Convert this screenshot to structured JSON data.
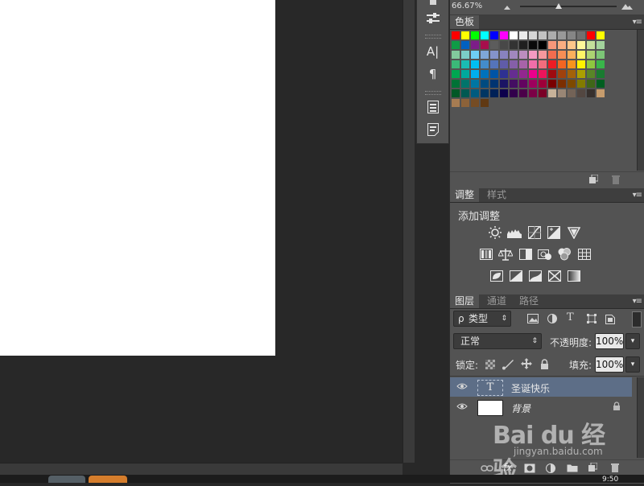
{
  "zoom": {
    "label": "66.67%"
  },
  "swatches_panel": {
    "tab": "色板",
    "colors": [
      "#ff0000",
      "#ffff00",
      "#00ff00",
      "#00ffff",
      "#0000ff",
      "#ff00ff",
      "#ffffff",
      "#ebebeb",
      "#d6d6d6",
      "#c2c2c2",
      "#adadad",
      "#999999",
      "#858585",
      "#707070",
      "#ff0000",
      "#ffff00",
      "#0e9c46",
      "#0060c0",
      "#7d1d88",
      "#a70e4c",
      "#5c5c5c",
      "#484848",
      "#333333",
      "#1f1f1f",
      "#0a0a0a",
      "#000000",
      "#f7977a",
      "#f9ad81",
      "#fdc68a",
      "#fff79a",
      "#c4df9b",
      "#a3d39c",
      "#82ca9d",
      "#7bcdc8",
      "#6ecff6",
      "#7ea7d8",
      "#8493ca",
      "#8882be",
      "#a187be",
      "#bc8dbf",
      "#f49ac2",
      "#f6989d",
      "#f26c4f",
      "#f68e55",
      "#fbaf5c",
      "#fff467",
      "#acd372",
      "#7cc576",
      "#3bb878",
      "#1abbb4",
      "#00bff3",
      "#438ccb",
      "#5574b9",
      "#605ca8",
      "#855fa8",
      "#a763a8",
      "#f06ea9",
      "#f26d7d",
      "#ed1c24",
      "#f26522",
      "#f7941d",
      "#fff200",
      "#8dc73f",
      "#39b54a",
      "#00a651",
      "#00a99d",
      "#00aeef",
      "#0072bc",
      "#0054a6",
      "#2e3192",
      "#662d91",
      "#92278f",
      "#ec008c",
      "#ed145b",
      "#9e0b0f",
      "#a0410d",
      "#a36209",
      "#aba000",
      "#598527",
      "#197b30",
      "#007236",
      "#00746b",
      "#0076a3",
      "#004b80",
      "#003471",
      "#1b1464",
      "#440e62",
      "#630460",
      "#9e005d",
      "#9e0039",
      "#790000",
      "#7b2e00",
      "#7d4900",
      "#827b00",
      "#406618",
      "#005e20",
      "#005826",
      "#005952",
      "#005b7f",
      "#003663",
      "#002157",
      "#0d004c",
      "#32004b",
      "#4b0049",
      "#7b0046",
      "#7a0026",
      "#c7b299",
      "#998675",
      "#736357",
      "#534741",
      "#37302d",
      "#c69c6d",
      "#a67c52",
      "#8c6239",
      "#754c24",
      "#603913"
    ]
  },
  "adjustments_panel": {
    "tabs": [
      "调整",
      "样式"
    ],
    "title": "添加调整",
    "row1": [
      "brightness-contrast-icon",
      "levels-icon",
      "curves-icon",
      "exposure-icon",
      "vibrance-icon"
    ],
    "row2": [
      "hue-saturation-icon",
      "color-balance-icon",
      "black-white-icon",
      "photo-filter-icon",
      "channel-mixer-icon",
      "color-lookup-icon"
    ],
    "row3": [
      "invert-icon",
      "posterize-icon",
      "threshold-icon",
      "selective-color-icon",
      "gradient-map-icon"
    ]
  },
  "layers_panel": {
    "tabs": [
      "图层",
      "通道",
      "路径"
    ],
    "filter_label": "类型",
    "filter_prefix": "ρ",
    "blend_mode": "正常",
    "opacity_label": "不透明度:",
    "opacity_value": "100%",
    "lock_label": "锁定:",
    "fill_label": "填充:",
    "fill_value": "100%",
    "layers": [
      {
        "name": "圣诞快乐",
        "thumb_glyph": "T"
      },
      {
        "name": "背景"
      }
    ]
  },
  "watermark": {
    "logo": "Bai du 经验",
    "url": "jingyan.baidu.com"
  },
  "taskbar": {
    "clock": "9:50"
  }
}
